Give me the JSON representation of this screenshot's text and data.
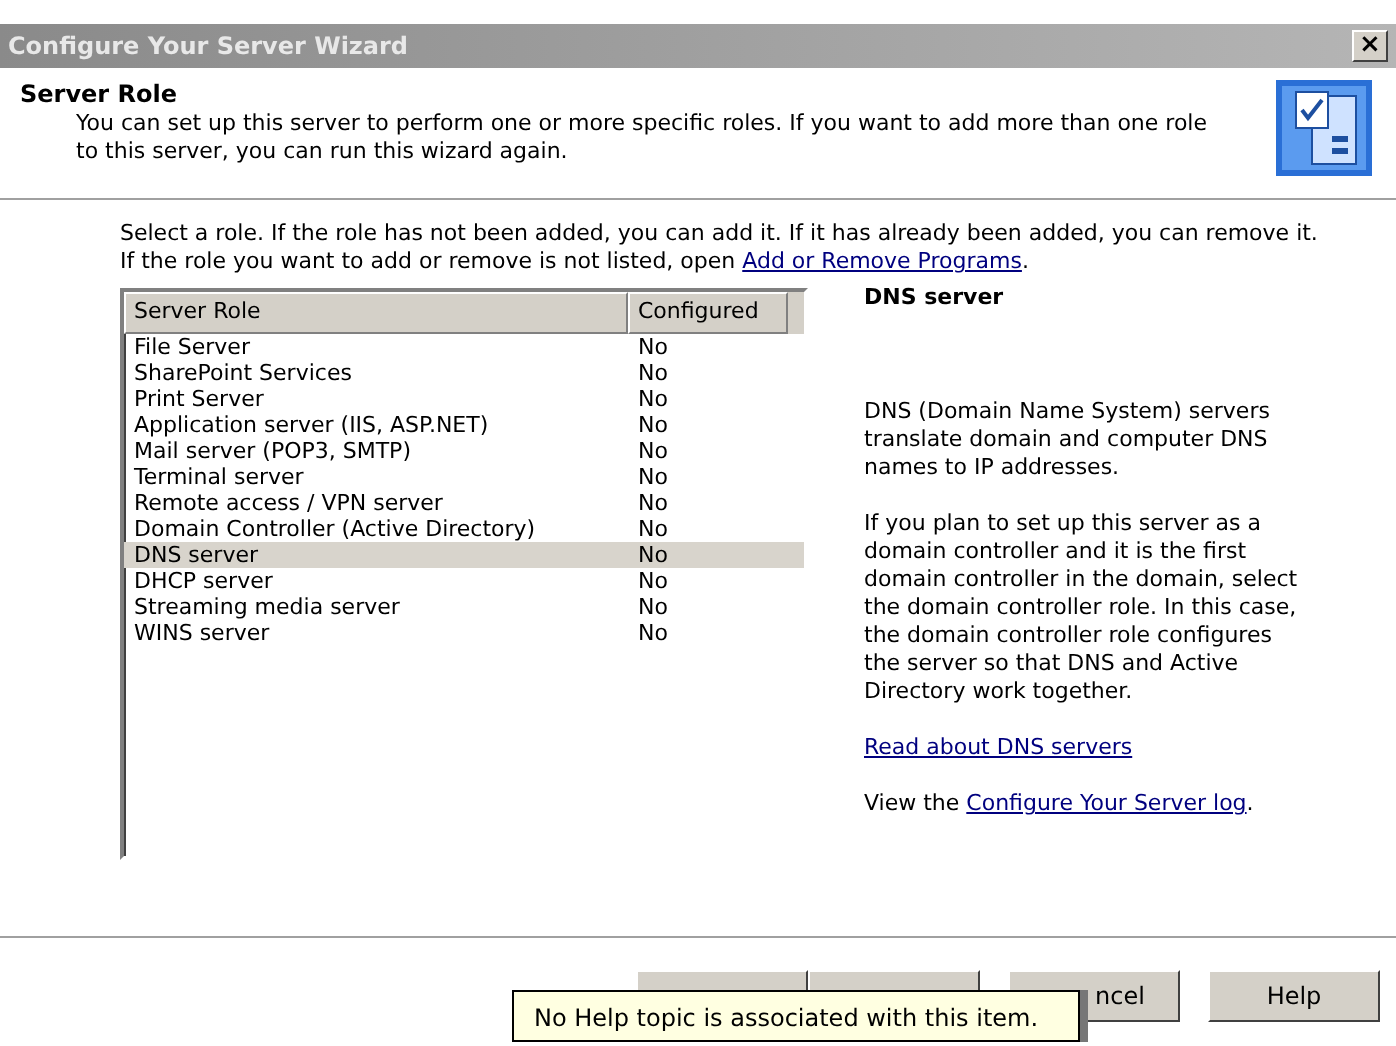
{
  "window": {
    "title": "Configure Your Server Wizard",
    "close": "×"
  },
  "header": {
    "title": "Server Role",
    "description": "You can set up this server to perform one or more specific roles. If you want to add more than one role to this server, you can run this wizard again."
  },
  "instructions": {
    "text": "Select a role. If the role has not been added, you can add it. If it has already been added, you can remove it. If the role you want to add or remove is not listed, open ",
    "link": "Add or Remove Programs",
    "end": "."
  },
  "table": {
    "columns": [
      "Server Role",
      "Configured"
    ],
    "rows": [
      {
        "role": "File Server",
        "configured": "No",
        "selected": false
      },
      {
        "role": "SharePoint Services",
        "configured": "No",
        "selected": false
      },
      {
        "role": "Print Server",
        "configured": "No",
        "selected": false
      },
      {
        "role": "Application server (IIS, ASP.NET)",
        "configured": "No",
        "selected": false
      },
      {
        "role": "Mail server (POP3, SMTP)",
        "configured": "No",
        "selected": false
      },
      {
        "role": "Terminal server",
        "configured": "No",
        "selected": false
      },
      {
        "role": "Remote access / VPN server",
        "configured": "No",
        "selected": false
      },
      {
        "role": "Domain Controller (Active Directory)",
        "configured": "No",
        "selected": false
      },
      {
        "role": "DNS server",
        "configured": "No",
        "selected": true
      },
      {
        "role": "DHCP server",
        "configured": "No",
        "selected": false
      },
      {
        "role": "Streaming media server",
        "configured": "No",
        "selected": false
      },
      {
        "role": "WINS server",
        "configured": "No",
        "selected": false
      }
    ]
  },
  "details": {
    "title": "DNS server",
    "paragraphs": [
      "DNS (Domain Name System) servers translate domain and computer DNS names to IP addresses.",
      "If you plan to set up this server as a domain controller and it is the first domain controller in the domain, select the domain controller role. In this case, the domain controller role configures the server so that DNS and Active Directory work together."
    ],
    "read_link": "Read about DNS servers",
    "log_prefix": "View the ",
    "log_link": "Configure Your Server log",
    "log_end": "."
  },
  "buttons": [
    {
      "kind": "back"
    },
    {
      "kind": "next"
    },
    {
      "kind": "cancel",
      "label": "ncel"
    },
    {
      "kind": "help",
      "label": "Help"
    }
  ],
  "tooltip": "No Help topic is associated with this item."
}
